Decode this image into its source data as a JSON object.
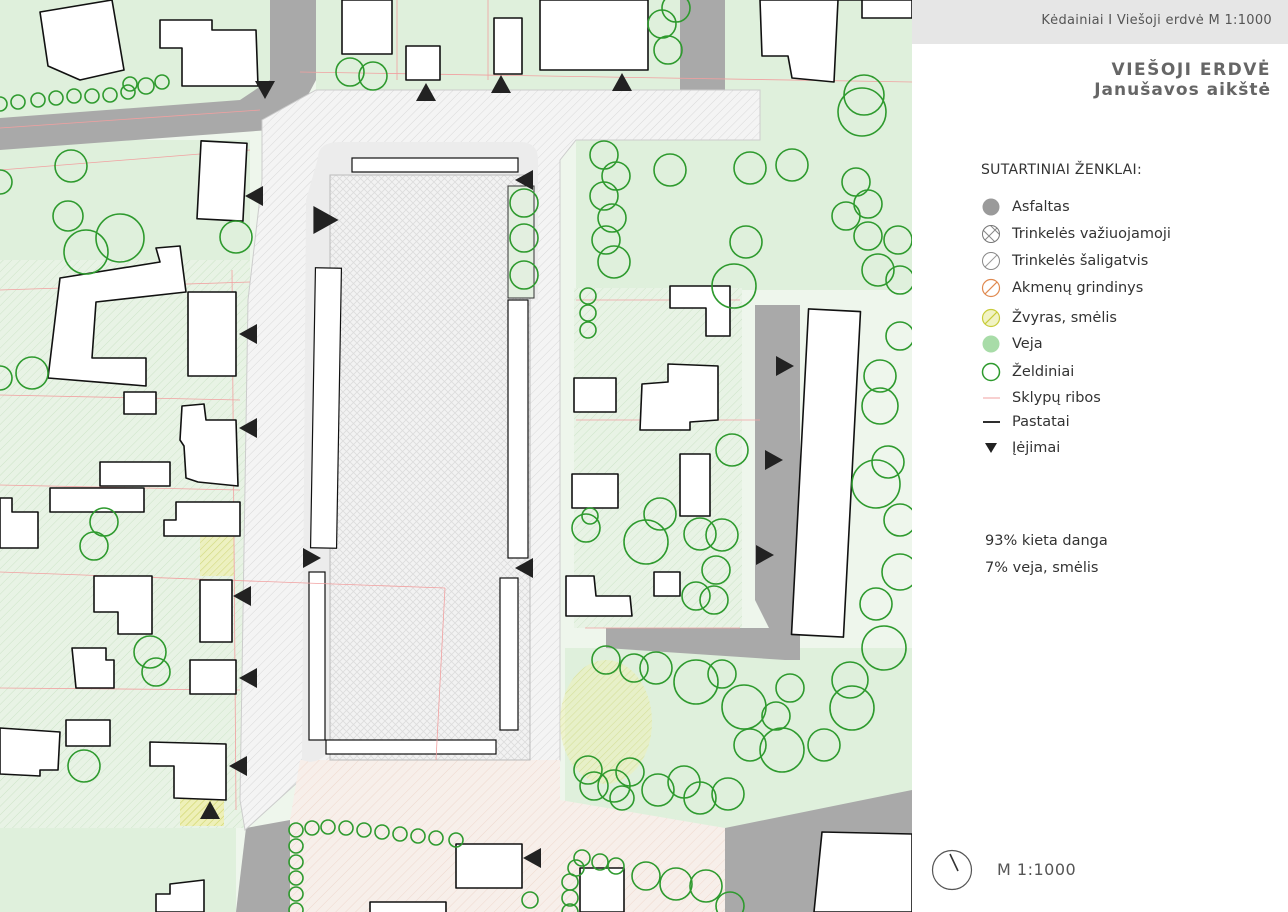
{
  "header": {
    "text": "Kėdainiai I Viešoji erdvė  M 1:1000"
  },
  "title": {
    "line1": "VIEŠOJI ERDVĖ",
    "line2": "Janušavos aikštė"
  },
  "legend": {
    "heading": "SUTARTINIAI ŽENKLAI:",
    "items": [
      {
        "key": "asfaltas",
        "label": "Asfaltas",
        "icon": "filled-grey-circle",
        "color": "#9a9a9a"
      },
      {
        "key": "trinkeles-vaziuojamoji",
        "label": "Trinkelės važiuojamoji",
        "icon": "crosshatch-circle",
        "color": "#888888"
      },
      {
        "key": "trinkeles-saligatvis",
        "label": "Trinkelės šaligatvis",
        "icon": "diagonal-hatch-circle",
        "color": "#999999"
      },
      {
        "key": "akmenu-grindinys",
        "label": "Akmenų grindinys",
        "icon": "orange-hatch-circle",
        "color": "#e08a50"
      },
      {
        "key": "zvyras-smelis",
        "label": "Žvyras, smėlis",
        "icon": "yellow-hatch-circle",
        "color": "#c8cc3a"
      },
      {
        "key": "veja",
        "label": "Veja",
        "icon": "green-filled-circle",
        "color": "#a8dca8"
      },
      {
        "key": "zeldiniai",
        "label": "Želdiniai",
        "icon": "tree-outline-circle",
        "color": "#2e9a2e"
      },
      {
        "key": "sklypu-ribos",
        "label": "Sklypų ribos",
        "icon": "thin-red-line",
        "color": "#f0a0a0"
      },
      {
        "key": "pastatai",
        "label": "Pastatai",
        "icon": "black-line",
        "color": "#111111"
      },
      {
        "key": "iejimai",
        "label": "Įėjimai",
        "icon": "entrance-triangle",
        "color": "#222222"
      }
    ]
  },
  "stats": {
    "hard_surface": "93% kieta danga",
    "lawn_sand": "7% veja, smėlis"
  },
  "scale": {
    "label": "M 1:1000"
  },
  "colors": {
    "lawn": "#dff0dc",
    "tree": "#2e9a2e",
    "asphalt": "#a9a9a9",
    "building": "#ffffff",
    "outline": "#111111",
    "plot_line": "#f1a0a0",
    "gravel": "#e9ebaa",
    "paving": "#f3f3f3"
  }
}
